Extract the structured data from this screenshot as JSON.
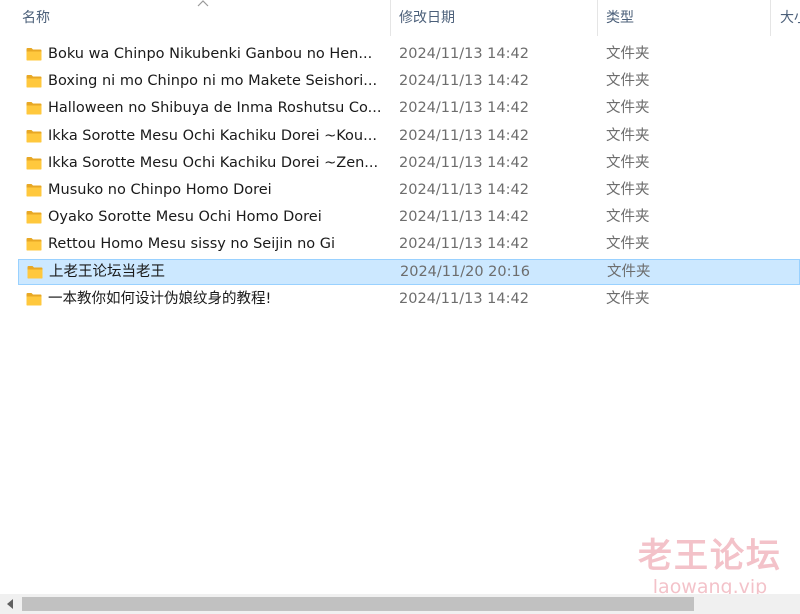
{
  "columns": {
    "name": "名称",
    "date_modified": "修改日期",
    "type": "类型",
    "size": "大小"
  },
  "files": [
    {
      "name": "Boku wa Chinpo Nikubenki Ganbou no Hen...",
      "date": "2024/11/13 14:42",
      "type": "文件夹",
      "icon": "folder-icon",
      "selected": false
    },
    {
      "name": "Boxing ni mo Chinpo ni mo Makete Seishori...",
      "date": "2024/11/13 14:42",
      "type": "文件夹",
      "icon": "folder-icon",
      "selected": false
    },
    {
      "name": "Halloween no Shibuya de Inma Roshutsu Co...",
      "date": "2024/11/13 14:42",
      "type": "文件夹",
      "icon": "folder-icon",
      "selected": false
    },
    {
      "name": "Ikka Sorotte Mesu Ochi Kachiku Dorei ~Kou...",
      "date": "2024/11/13 14:42",
      "type": "文件夹",
      "icon": "folder-icon",
      "selected": false
    },
    {
      "name": "Ikka Sorotte Mesu Ochi Kachiku Dorei ~Zen...",
      "date": "2024/11/13 14:42",
      "type": "文件夹",
      "icon": "folder-icon",
      "selected": false
    },
    {
      "name": "Musuko no Chinpo Homo Dorei",
      "date": "2024/11/13 14:42",
      "type": "文件夹",
      "icon": "folder-icon",
      "selected": false
    },
    {
      "name": "Oyako Sorotte Mesu Ochi Homo Dorei",
      "date": "2024/11/13 14:42",
      "type": "文件夹",
      "icon": "folder-icon",
      "selected": false
    },
    {
      "name": "Rettou Homo Mesu sissy no Seijin no Gi",
      "date": "2024/11/13 14:42",
      "type": "文件夹",
      "icon": "folder-icon",
      "selected": false
    },
    {
      "name": "上老王论坛当老王",
      "date": "2024/11/20 20:16",
      "type": "文件夹",
      "icon": "folder-icon",
      "selected": true
    },
    {
      "name": "一本教你如何设计伪娘纹身的教程!",
      "date": "2024/11/13 14:42",
      "type": "文件夹",
      "icon": "folder-icon",
      "selected": false
    }
  ],
  "watermark": {
    "cn": "老王论坛",
    "en": "laowang.vip"
  },
  "colors": {
    "selection_bg": "#cce8ff",
    "selection_border": "#99d1ff",
    "folder_yellow": "#ffc83d",
    "header_text": "#4c607a",
    "watermark": "#f0aeb8"
  }
}
